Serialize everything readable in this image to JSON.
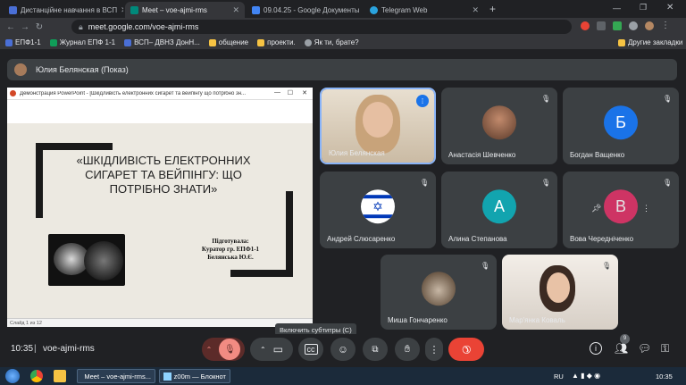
{
  "browser": {
    "tabs": [
      {
        "label": "Дистанційне навчання в ВСП",
        "active": false,
        "favicon_color": "#4a6fd6"
      },
      {
        "label": "Meet – voe-ajmi-rms",
        "active": true,
        "favicon_color": "#00897b"
      },
      {
        "label": "09.04.25 - Google Документы",
        "active": false,
        "favicon_color": "#4285f4"
      },
      {
        "label": "Telegram Web",
        "active": false,
        "favicon_color": "#2aa3de"
      }
    ],
    "url": "meet.google.com/voe-ajmi-rms",
    "bookmarks": [
      "ЕПФ1-1",
      "Журнал ЕПФ 1-1",
      "ВСП– ДВНЗ ДонН...",
      "общение",
      "проекти.",
      "Як ти, брате?"
    ],
    "other_bookmarks": "Другие закладки"
  },
  "meet": {
    "presenter_label": "Юлия Белянская (Показ)",
    "shared_window": {
      "title": "Демонстрация PowerPoint - [Шкідливість електронних сигарет та вейпінгу що потрібно зн...",
      "slide_title": "«ШКІДЛИВІСТЬ ЕЛЕКТРОННИХ СИГАРЕТ ТА ВЕЙПІНГУ: ЩО ПОТРІБНО ЗНАТИ»",
      "prepared_by": "Підготувала:",
      "curator": "Куратор гр. ЕПФ1-1",
      "author": "Белянська Ю.Є.",
      "slide_counter": "Слайд 1 из 12"
    },
    "participants": [
      {
        "name": "Юлия Белянская",
        "type": "video",
        "speaking": true
      },
      {
        "name": "Анастасія Шевченко",
        "type": "photo",
        "muted": true
      },
      {
        "name": "Богдан Ващенко",
        "type": "initial",
        "initial": "Б",
        "color": "#1a73e8",
        "muted": true
      },
      {
        "name": "Андрей Слюсаренко",
        "type": "flag",
        "muted": true
      },
      {
        "name": "Алина Степанова",
        "type": "initial",
        "initial": "А",
        "color": "#12a4af",
        "muted": true
      },
      {
        "name": "Вова Чередніченко",
        "type": "initial",
        "initial": "В",
        "color": "#e8336a",
        "muted": true
      },
      {
        "name": "Миша Гончаренко",
        "type": "photo",
        "muted": true
      },
      {
        "name": "Мар'янка Коваль",
        "type": "video",
        "muted": true
      }
    ],
    "time": "10:35",
    "meeting_code": "voe-ajmi-rms",
    "tooltip": "Включить субтитры (C)",
    "participant_count": "9"
  },
  "taskbar": {
    "items": [
      "Meet – voe-ajmi-rms...",
      "z00m — Блокнот"
    ],
    "lang": "RU",
    "clock": "10:35"
  },
  "colors": {
    "end_call": "#ea4335",
    "mic_off": "#5c2b29",
    "accent": "#8ab4f8"
  }
}
